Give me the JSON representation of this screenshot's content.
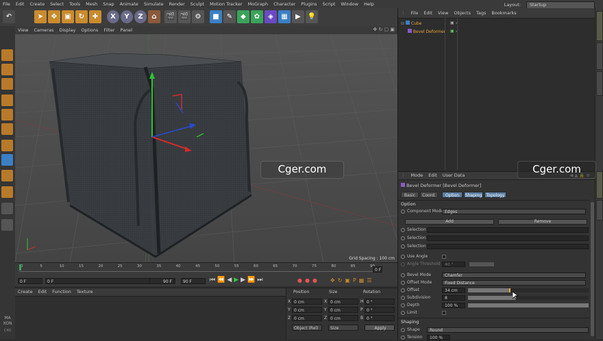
{
  "menubar": {
    "items": [
      "File",
      "Edit",
      "Create",
      "Select",
      "Tools",
      "Mesh",
      "Snap",
      "Animate",
      "Simulate",
      "Render",
      "Sculpt",
      "Motion Tracker",
      "MoGraph",
      "Character",
      "Plugins",
      "Script",
      "Window",
      "Help"
    ],
    "layout_label": "Layout:",
    "layout_value": "Startup"
  },
  "viewport": {
    "menu": [
      "View",
      "Cameras",
      "Display",
      "Options",
      "Filter",
      "Panel"
    ],
    "grid_spacing": "Grid Spacing : 100 cm"
  },
  "timeline": {
    "ticks": [
      "0",
      "5",
      "10",
      "15",
      "20",
      "25",
      "30",
      "35",
      "40",
      "45",
      "50",
      "55",
      "60",
      "65",
      "70",
      "75",
      "80",
      "85",
      "90"
    ],
    "end_label": "0 F"
  },
  "transport": {
    "start": "0 F",
    "current": "0 F",
    "end_a": "90 F",
    "end_b": "90 F"
  },
  "material": {
    "menu": [
      "Create",
      "Edit",
      "Function",
      "Texture"
    ]
  },
  "coords": {
    "headers": [
      "Position",
      "Size",
      "Rotation"
    ],
    "rows": [
      {
        "axis": "X",
        "pos": "0 cm",
        "sax": "X",
        "size": "0 cm",
        "rax": "H",
        "rot": "0 °"
      },
      {
        "axis": "Y",
        "pos": "0 cm",
        "sax": "Y",
        "size": "0 cm",
        "rax": "P",
        "rot": "0 °"
      },
      {
        "axis": "Z",
        "pos": "0 cm",
        "sax": "Z",
        "size": "0 cm",
        "rax": "B",
        "rot": "0 °"
      }
    ],
    "mode": "Object (Rel)",
    "size_mode": "Size",
    "apply": "Apply"
  },
  "objects": {
    "menu": [
      "File",
      "Edit",
      "View",
      "Objects",
      "Tags",
      "Bookmarks"
    ],
    "items": [
      "Cube",
      "Bevel Deformer"
    ]
  },
  "attributes": {
    "menu": [
      "Mode",
      "Edit",
      "User Data"
    ],
    "title": "Bevel Deformer [Bevel Deformer]",
    "tabs": [
      "Basic",
      "Coord.",
      "Option",
      "Shaping",
      "Topology"
    ],
    "section_option": "Option",
    "component_mode_label": "Component Mode",
    "component_mode": "Edges",
    "add": "Add",
    "remove": "Remove",
    "selection": "Selection",
    "use_angle": "Use Angle",
    "angle_threshold": "Angle Threshold",
    "angle_value": "40 °",
    "bevel_mode_label": "Bevel Mode",
    "bevel_mode": "Chamfer",
    "offset_mode_label": "Offset Mode",
    "offset_mode": "Fixed Distance",
    "offset_label": "Offset",
    "offset": "34 cm",
    "subdivision_label": "Subdivision",
    "subdivision": "8",
    "depth_label": "Depth",
    "depth": "100 %",
    "limit_label": "Limit",
    "section_shaping": "Shaping",
    "shape_label": "Shape",
    "shape": "Round",
    "tension_label": "Tension",
    "tension": "100 %"
  },
  "watermark": "Cger.com",
  "logo": "MAXON CINEMA 4D"
}
